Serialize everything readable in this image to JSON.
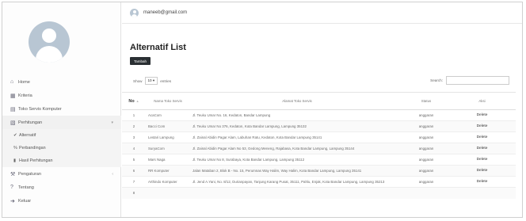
{
  "user": {
    "email": "maneeb@gmail.com"
  },
  "sidebar": {
    "items": [
      {
        "label": "Home",
        "icon": "home-icon",
        "glyph": "⌂"
      },
      {
        "label": "Kriteria",
        "icon": "grid-icon",
        "glyph": "▦"
      },
      {
        "label": "Toko Servis Komputer",
        "icon": "store-icon",
        "glyph": "▤"
      },
      {
        "label": "Perhitungan",
        "icon": "calc-icon",
        "glyph": "▧"
      }
    ],
    "sub_items": [
      {
        "label": "Alternatif",
        "icon": "check-icon",
        "glyph": "✔"
      },
      {
        "label": "Perbandingan",
        "icon": "percent-icon",
        "glyph": "%"
      },
      {
        "label": "Hasil Perhitungan",
        "icon": "bar-chart-icon",
        "glyph": "▮"
      }
    ],
    "bottom_items": [
      {
        "label": "Pengaturan",
        "icon": "settings-icon",
        "glyph": "⚒"
      },
      {
        "label": "Tentang",
        "icon": "question-icon",
        "glyph": "?"
      },
      {
        "label": "Keluar",
        "icon": "logout-icon",
        "glyph": "➜"
      }
    ]
  },
  "main": {
    "title": "Alternatif List",
    "add_button": "Tambah",
    "show_label": "Show",
    "show_value": "10",
    "entries_label": "entries",
    "search_label": "Search:"
  },
  "table": {
    "headers": [
      "No",
      "Nama Toko Servis",
      "Alamat Toko Servis",
      "Status",
      "Aksi"
    ],
    "rows": [
      {
        "no": "1",
        "nama": "AcaCom",
        "alamat": "Jl. Teuku Umar No. 16, Kedaton, Bandar Lampung",
        "status": "anggaran",
        "aksi": "Delete"
      },
      {
        "no": "2",
        "nama": "Bacci Com",
        "alamat": "Jl. Teuku Umar No 376, Kedaton, Kota Bandar Lampung, Lampung 35132",
        "status": "anggaran",
        "aksi": "Delete"
      },
      {
        "no": "3",
        "nama": "Lestari Lampung",
        "alamat": "Jl. Zainal Abidin Pagar Alam, Labuhan Ratu, Kedaton, Kota Bandar Lampung 35141",
        "status": "anggaran",
        "aksi": "Delete"
      },
      {
        "no": "4",
        "nama": "SuryaCom",
        "alamat": "Jl. Zainal Abidin Pagar Alam No 53, Gedong Meneng, Rajabasa, Kota Bandar Lampung, Lampung 35144",
        "status": "anggaran",
        "aksi": "Delete"
      },
      {
        "no": "5",
        "nama": "Mars Naga",
        "alamat": "Jl. Teuku Umar No 8, Surabaya, Kota Bandar Lampung, Lampung 35112",
        "status": "anggaran",
        "aksi": "Delete"
      },
      {
        "no": "6",
        "nama": "RR Komputer",
        "alamat": "Jalan Mataban 2, Blok B - No. 15, Perumnas Way Halim, Way Halim, Kota Bandar Lampung, Lampung 35141",
        "status": "anggaran",
        "aksi": "Delete"
      },
      {
        "no": "7",
        "nama": "Arthindo Komputer",
        "alamat": "Jl. Jend A.Yani, No. 8/12, Durianpayan, Tanjung Karang Pusat, 35111, Pahlu, Enjak, Kota Bandar Lampung, Lampung 35213",
        "status": "anggaran",
        "aksi": "Delete"
      },
      {
        "no": "8",
        "nama": "",
        "alamat": "",
        "status": "",
        "aksi": ""
      }
    ]
  }
}
